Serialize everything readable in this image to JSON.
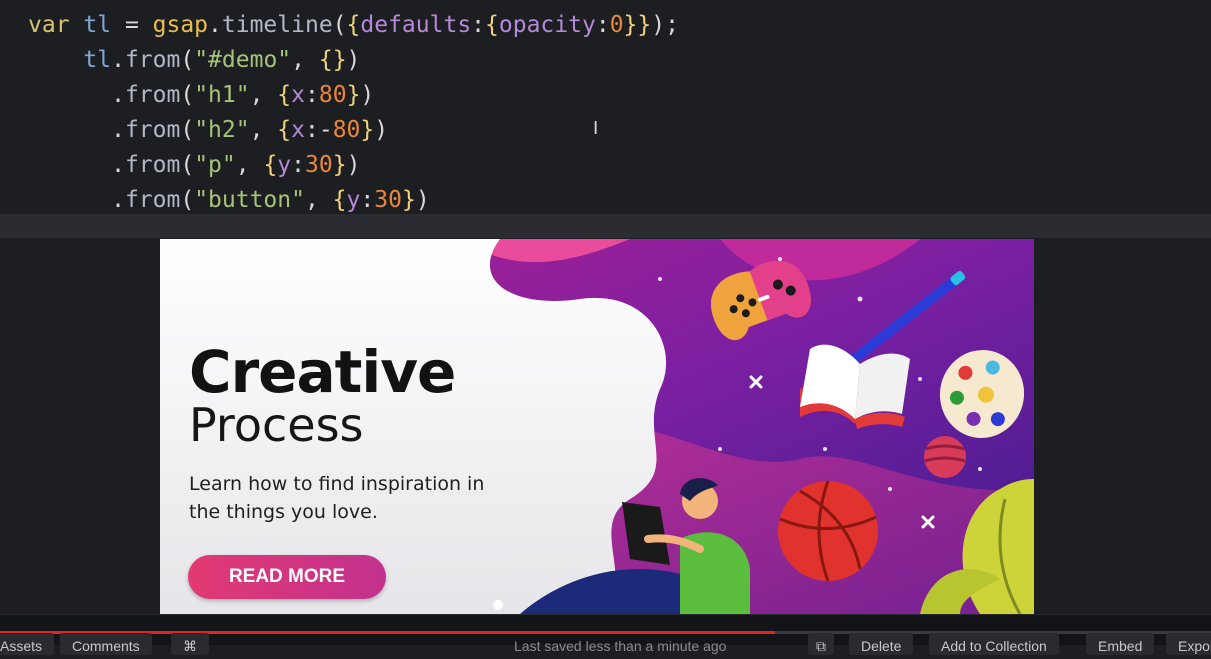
{
  "editor": {
    "lines": [
      [
        [
          "kw",
          "var "
        ],
        [
          "var",
          "tl"
        ],
        [
          "pun",
          " = "
        ],
        [
          "obj",
          "gsap"
        ],
        [
          "pun",
          "."
        ],
        [
          "fn",
          "timeline"
        ],
        [
          "pun",
          "("
        ],
        [
          "brace",
          "{"
        ],
        [
          "prop",
          "defaults"
        ],
        [
          "pun",
          ":"
        ],
        [
          "brace",
          "{"
        ],
        [
          "prop",
          "opacity"
        ],
        [
          "pun",
          ":"
        ],
        [
          "num",
          "0"
        ],
        [
          "brace",
          "}}"
        ],
        [
          "pun",
          ");"
        ]
      ],
      [
        [
          "pun",
          "    "
        ],
        [
          "var",
          "tl"
        ],
        [
          "pun",
          "."
        ],
        [
          "fn",
          "from"
        ],
        [
          "pun",
          "("
        ],
        [
          "str",
          "\"#demo\""
        ],
        [
          "pun",
          ", "
        ],
        [
          "brace",
          "{}"
        ],
        [
          "pun",
          ")"
        ]
      ],
      [
        [
          "pun",
          "      ."
        ],
        [
          "fn",
          "from"
        ],
        [
          "pun",
          "("
        ],
        [
          "str",
          "\"h1\""
        ],
        [
          "pun",
          ", "
        ],
        [
          "brace",
          "{"
        ],
        [
          "prop",
          "x"
        ],
        [
          "pun",
          ":"
        ],
        [
          "num",
          "80"
        ],
        [
          "brace",
          "}"
        ],
        [
          "pun",
          ")"
        ]
      ],
      [
        [
          "pun",
          "      ."
        ],
        [
          "fn",
          "from"
        ],
        [
          "pun",
          "("
        ],
        [
          "str",
          "\"h2\""
        ],
        [
          "pun",
          ", "
        ],
        [
          "brace",
          "{"
        ],
        [
          "prop",
          "x"
        ],
        [
          "pun",
          ":-"
        ],
        [
          "num",
          "80"
        ],
        [
          "brace",
          "}"
        ],
        [
          "pun",
          ")"
        ]
      ],
      [
        [
          "pun",
          "      ."
        ],
        [
          "fn",
          "from"
        ],
        [
          "pun",
          "("
        ],
        [
          "str",
          "\"p\""
        ],
        [
          "pun",
          ", "
        ],
        [
          "brace",
          "{"
        ],
        [
          "prop",
          "y"
        ],
        [
          "pun",
          ":"
        ],
        [
          "num",
          "30"
        ],
        [
          "brace",
          "}"
        ],
        [
          "pun",
          ")"
        ]
      ],
      [
        [
          "pun",
          "      ."
        ],
        [
          "fn",
          "from"
        ],
        [
          "pun",
          "("
        ],
        [
          "str",
          "\"button\""
        ],
        [
          "pun",
          ", "
        ],
        [
          "brace",
          "{"
        ],
        [
          "prop",
          "y"
        ],
        [
          "pun",
          ":"
        ],
        [
          "num",
          "30"
        ],
        [
          "brace",
          "}"
        ],
        [
          "pun",
          ")"
        ]
      ]
    ],
    "cursor_glyph": "I"
  },
  "preview": {
    "headline": "Creative",
    "subhead": "Process",
    "description": "Learn how to find inspiration in the things you love.",
    "button_label": "READ MORE",
    "colors": {
      "purple": "#6a1fa0",
      "magenta": "#d63a8e",
      "button_start": "#e23a72",
      "button_end": "#c2318e"
    },
    "icons": [
      "game-controller-icon",
      "pencil-icon",
      "open-book-icon",
      "paint-palette-icon",
      "planet-icon",
      "basketball-icon",
      "sparkle-icon",
      "leaf-icon",
      "person-with-laptop-icon"
    ]
  },
  "bottombar": {
    "assets": "Assets",
    "comments": "Comments",
    "shortcut": "⌘",
    "saved_text": "Last saved less than a minute ago",
    "open_icon": "⧉",
    "delete": "Delete",
    "add_to_collection": "Add to Collection",
    "embed": "Embed",
    "export": "Export",
    "progress": 0.64,
    "accent": "#e02424"
  }
}
